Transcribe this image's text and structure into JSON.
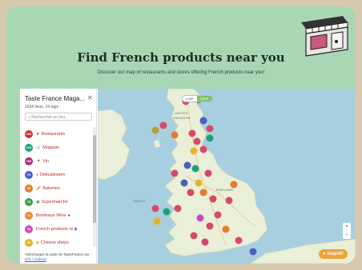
{
  "header": {
    "title": "Find French products near you",
    "subtitle": "Discover our map of restaurants and stores offering French products near you!"
  },
  "sidebar": {
    "title": "Taste France Maga...",
    "meta": "1034 lieux, 14 tags ·",
    "search_placeholder": "Rechercher un lieu...",
    "items": [
      {
        "count": "284",
        "label": "Restaurants",
        "icon": "star-icon",
        "color": "#d12d34"
      },
      {
        "count": "104",
        "label": "Magasin",
        "icon": "cart-icon",
        "color": "#19a37a"
      },
      {
        "count": "106",
        "label": "Vin",
        "icon": "wine-glass-icon",
        "color": "#b3287a"
      },
      {
        "count": "70",
        "label": "Delicatessen",
        "icon": "deli-icon",
        "color": "#4b5fc1"
      },
      {
        "count": "46",
        "label": "Bakeries",
        "icon": "bread-icon",
        "color": "#e47b2f"
      },
      {
        "count": "78",
        "label": "Supermarché",
        "icon": "supermarket-icon",
        "color": "#3aa04a"
      },
      {
        "count": "71",
        "label": "Bordeaux Wine",
        "icon": "grapes-icon",
        "color": "#e48c2a"
      },
      {
        "count": "33",
        "label": "French products re",
        "icon": "flag-icon",
        "color": "#c84ac2"
      },
      {
        "count": "20",
        "label": "Cheese shops",
        "icon": "cheese-icon",
        "color": "#e2b42a"
      }
    ],
    "footer_text": "Téléchargez la carte de TasteFrance sur",
    "footer_link": "iOS / Android"
  },
  "map": {
    "toggle_left": "Liste",
    "toggle_right": "Carte",
    "labels": [
      "UNITED",
      "KINGDOM",
      "WALES",
      "ENGLAND",
      "Manchester",
      "London"
    ],
    "brand": "mapstr",
    "zoom_in": "+",
    "zoom_out": "−",
    "colors": {
      "land": "#e9efd8",
      "sea": "#a8cfe0",
      "brand": "#f2a23a"
    }
  }
}
